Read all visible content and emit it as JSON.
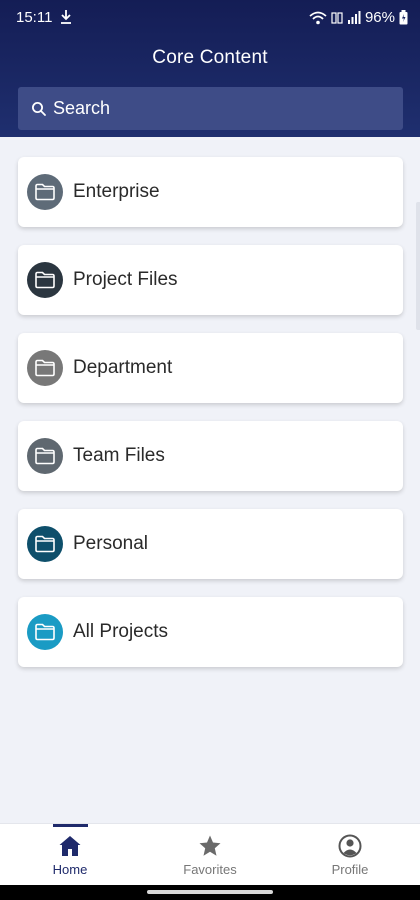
{
  "status_bar": {
    "time": "15:11",
    "battery": "96%"
  },
  "header": {
    "title": "Core Content"
  },
  "search": {
    "placeholder": "Search"
  },
  "folders": [
    {
      "label": "Enterprise",
      "color": "#5e6b78"
    },
    {
      "label": "Project Files",
      "color": "#2b3640"
    },
    {
      "label": "Department",
      "color": "#787878"
    },
    {
      "label": "Team Files",
      "color": "#5f6870"
    },
    {
      "label": "Personal",
      "color": "#0e4f6b"
    },
    {
      "label": "All Projects",
      "color": "#1a9bc4"
    }
  ],
  "bottom_nav": {
    "items": [
      {
        "label": "Home",
        "icon": "home-icon",
        "active": true
      },
      {
        "label": "Favorites",
        "icon": "star-icon",
        "active": false
      },
      {
        "label": "Profile",
        "icon": "profile-icon",
        "active": false
      }
    ]
  },
  "colors": {
    "header_bg": "#17215d",
    "accent": "#1f2a6b",
    "page_bg": "#f0f2f8"
  }
}
